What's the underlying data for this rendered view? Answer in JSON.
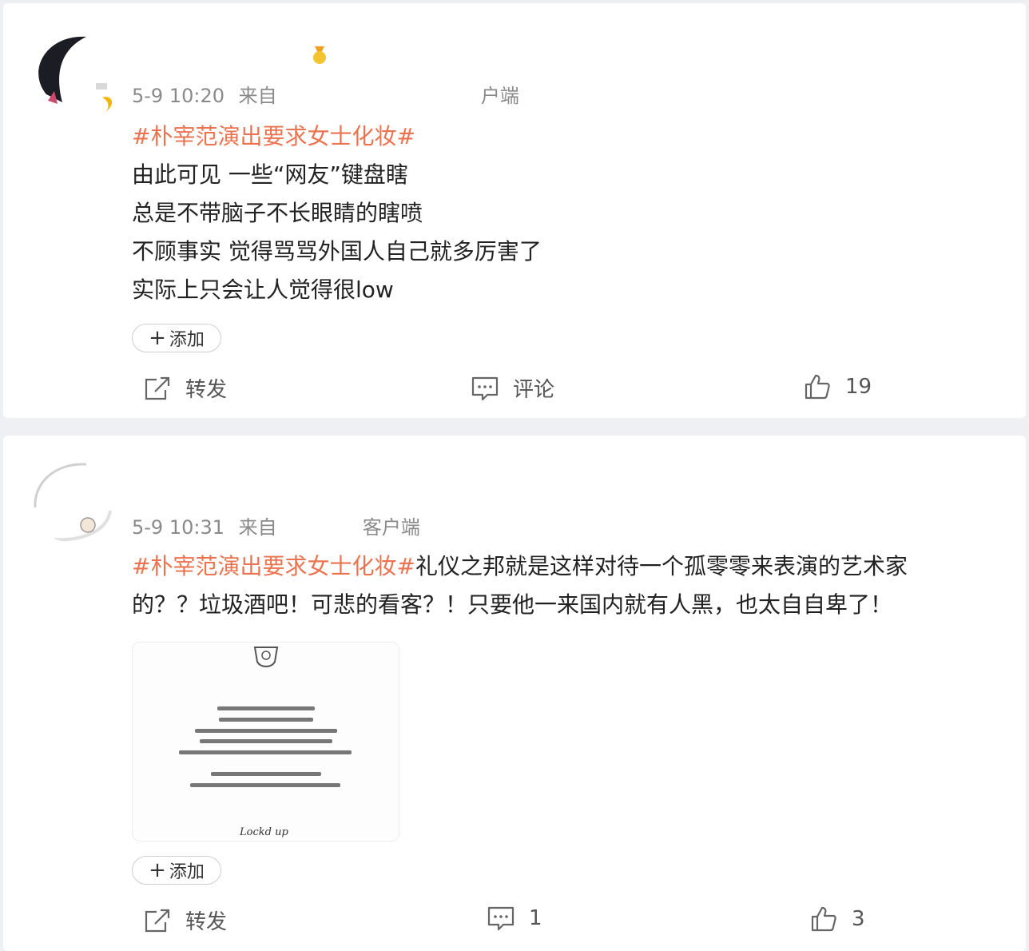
{
  "posts": [
    {
      "time": "5-9 10:20",
      "source_prefix": "来自",
      "source_suffix": "户端",
      "hashtag": "#朴宰范演出要求女士化妆#",
      "body_after_hashtag": "",
      "lines": [
        "由此可见 一些“网友”键盘瞎",
        "总是不带脑子不长眼睛的瞎喷",
        "不顾事实 觉得骂骂外国人自己就多厉害了",
        "实际上只会让人觉得很low"
      ],
      "add_label": "添加",
      "repost_label": "转发",
      "comment_label": "评论",
      "like_count": "19"
    },
    {
      "time": "5-9 10:31",
      "source_prefix": "来自",
      "source_suffix": "客户端",
      "hashtag": "#朴宰范演出要求女士化妆#",
      "body_after_hashtag": "礼仪之邦就是这样对待一个孤零零来表演的艺术家",
      "lines": [
        "的？？垃圾酒吧！可悲的看客？！只要他一来国内就有人黑，也太自自卑了！"
      ],
      "add_label": "添加",
      "repost_label": "转发",
      "comment_count": "1",
      "like_count": "3",
      "attachment": {
        "signature": "Lockd up"
      }
    }
  ],
  "colors": {
    "hashtag": "#eb7350",
    "meta": "#8a8a8a",
    "page_bg": "#eef0f3"
  },
  "icons": {
    "repost": "share-icon",
    "comment": "comment-icon",
    "like": "thumbs-up-icon",
    "add": "plus-icon"
  }
}
